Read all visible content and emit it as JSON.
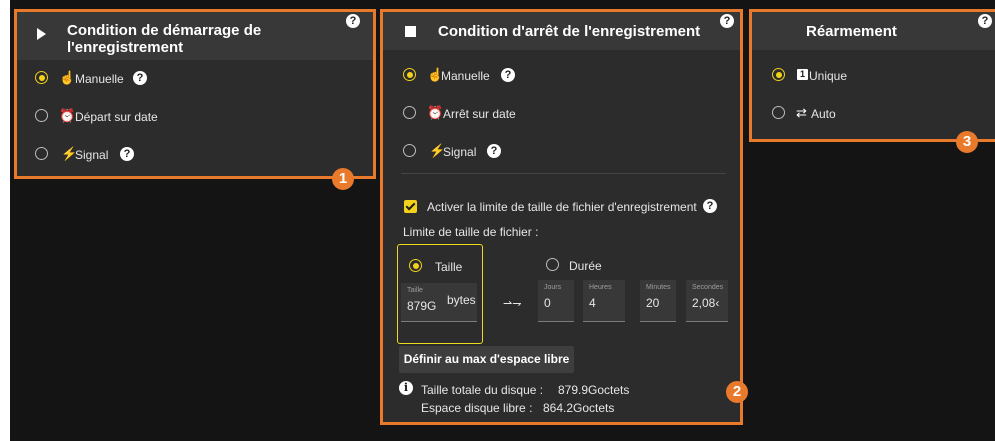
{
  "start_panel": {
    "title": "Condition de démarrage de l'enregistrement",
    "help_icon": "?",
    "options": [
      {
        "label": "Manuelle",
        "icon": "manual-icon",
        "selected": true,
        "has_help": true
      },
      {
        "label": "Départ sur date",
        "icon": "alarm-clock-icon",
        "selected": false,
        "has_help": false
      },
      {
        "label": "Signal",
        "icon": "lightning-icon",
        "selected": false,
        "has_help": true
      }
    ],
    "badge": "1"
  },
  "stop_panel": {
    "title": "Condition d'arrêt de l'enregistrement",
    "help_icon": "?",
    "options": [
      {
        "label": "Manuelle",
        "icon": "manual-icon",
        "selected": true,
        "has_help": true
      },
      {
        "label": "Arrêt sur date",
        "icon": "alarm-clock-icon",
        "selected": false,
        "has_help": false
      },
      {
        "label": "Signal",
        "icon": "lightning-icon",
        "selected": false,
        "has_help": true
      }
    ],
    "limit_checkbox_label": "Activer la limite de taille de fichier d'enregistrement",
    "limit_checked": true,
    "limit_section_label": "Limite de taille de fichier :",
    "size_option": {
      "label": "Taille",
      "selected": true,
      "field_label": "Taille",
      "value": "879G",
      "unit": "bytes"
    },
    "duration_option": {
      "label": "Durée",
      "selected": false,
      "fields": [
        {
          "label": "Jours",
          "value": "0"
        },
        {
          "label": "Heures",
          "value": "4"
        },
        {
          "label": "Minutes",
          "value": "20"
        },
        {
          "label": "Secondes",
          "value": "2,08‹"
        }
      ]
    },
    "max_button_label": "Définir au max d'espace libre",
    "info": {
      "total_label": "Taille totale du disque :",
      "total_value": "879.9Goctets",
      "free_label": "Espace disque libre :",
      "free_value": "864.2Goctets"
    },
    "badge": "2"
  },
  "rearm_panel": {
    "title": "Réarmement",
    "help_icon": "?",
    "options": [
      {
        "label": "Unique",
        "icon": "single-icon",
        "icon_text": "1",
        "selected": true
      },
      {
        "label": "Auto",
        "icon": "repeat-icon",
        "selected": false
      }
    ],
    "badge": "3"
  },
  "colors": {
    "accent": "#f2d21a",
    "highlight": "#ea7a2b",
    "panel": "#2c2c2c",
    "header": "#383838"
  }
}
